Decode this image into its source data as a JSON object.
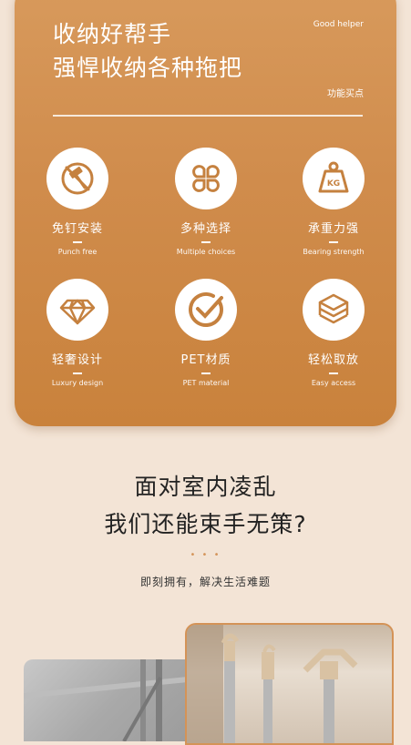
{
  "card": {
    "title_line1": "收纳好帮手",
    "title_line2": "强悍收纳各种拖把",
    "good_helper": "Good helper",
    "selling_points": "功能买点"
  },
  "features": [
    {
      "icon": "no-hammer-icon",
      "title": "免钉安装",
      "subtitle": "Punch free"
    },
    {
      "icon": "four-petal-icon",
      "title": "多种选择",
      "subtitle": "Multiple choices"
    },
    {
      "icon": "kg-weight-icon",
      "title": "承重力强",
      "subtitle": "Bearing strength"
    },
    {
      "icon": "diamond-icon",
      "title": "轻奢设计",
      "subtitle": "Luxury design"
    },
    {
      "icon": "checkmark-icon",
      "title": "PET材质",
      "subtitle": "PET material"
    },
    {
      "icon": "layers-icon",
      "title": "轻松取放",
      "subtitle": "Easy access"
    }
  ],
  "headline": {
    "line1": "面对室内凌乱",
    "line2": "我们还能束手无策?",
    "dots": "• • •",
    "subtitle": "即刻拥有，解决生活难题"
  },
  "colors": {
    "accent": "#d08c4c",
    "background": "#f3e4d6",
    "icon_stroke": "#c5813f"
  }
}
